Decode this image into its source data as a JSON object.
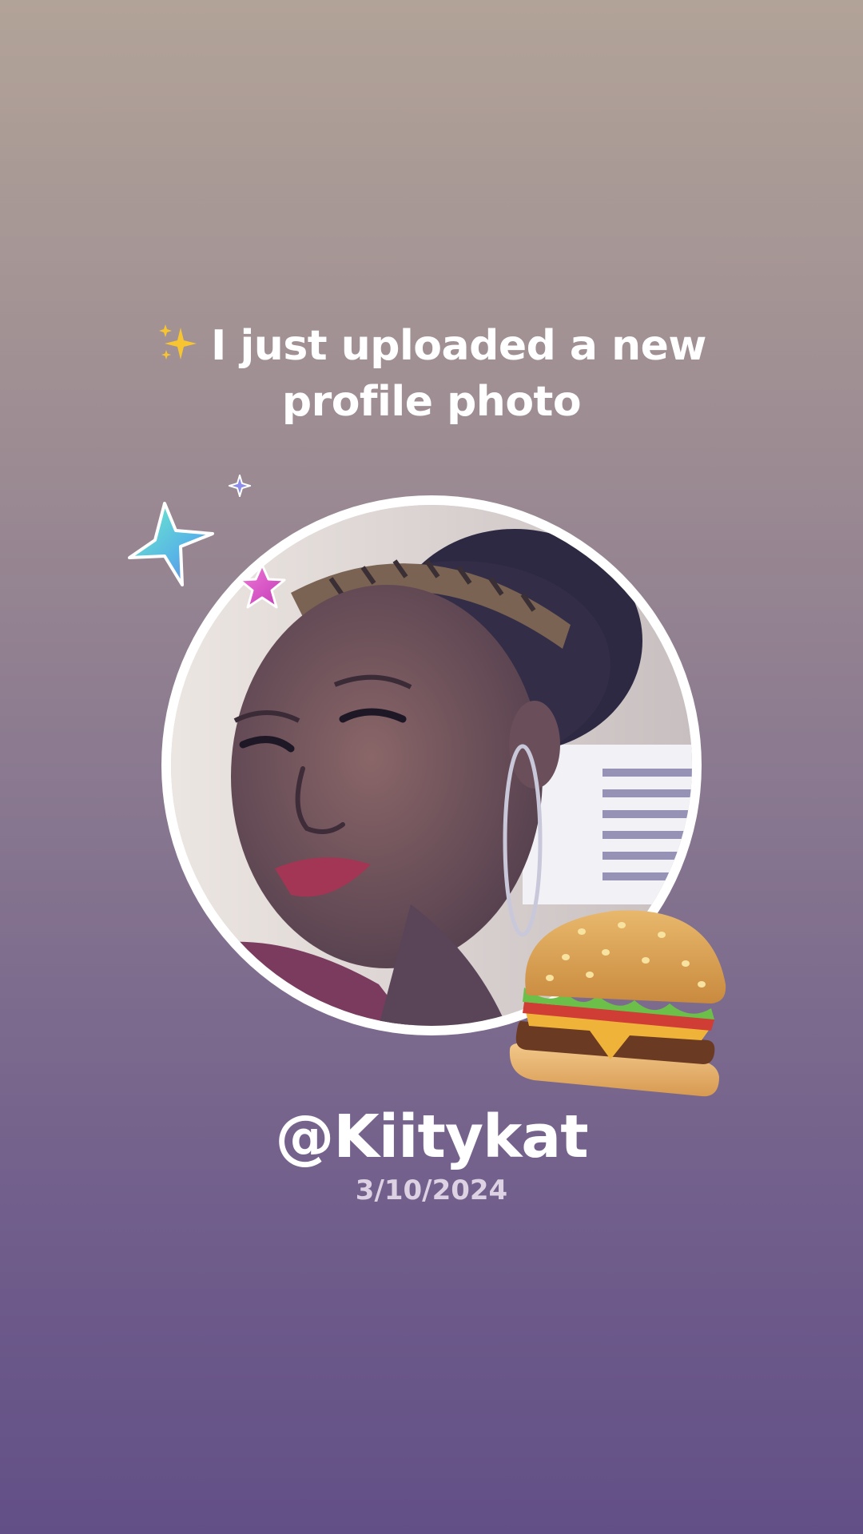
{
  "post": {
    "headline_line1": "I just uploaded a new",
    "headline_line2": "profile photo",
    "username": "@Kiitykat",
    "date": "3/10/2024"
  },
  "decorations": {
    "headline_icon": "sparkles-emoji",
    "stickers": [
      "teal-star-icon",
      "small-purple-star-icon",
      "pink-star-icon",
      "hamburger-emoji"
    ]
  },
  "colors": {
    "background_top": "#b2a398",
    "background_bottom": "#624f86",
    "text_primary": "#ffffff",
    "text_secondary": "#ddd2e3",
    "avatar_ring": "#ffffff"
  }
}
